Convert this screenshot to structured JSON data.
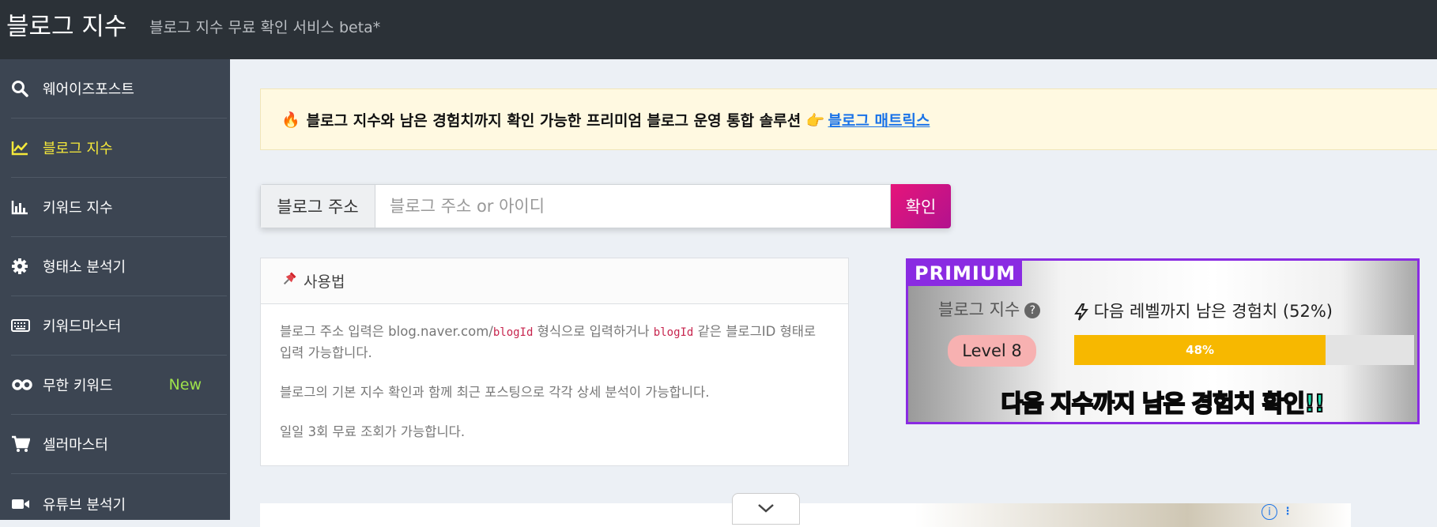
{
  "header": {
    "brand": "블로그 지수",
    "subtitle": "블로그 지수 무료 확인 서비스 beta*"
  },
  "sidebar": {
    "items": [
      {
        "label": "웨어이즈포스트",
        "icon": "search-icon"
      },
      {
        "label": "블로그 지수",
        "icon": "line-chart-icon",
        "active": true
      },
      {
        "label": "키워드 지수",
        "icon": "bar-chart-icon"
      },
      {
        "label": "형태소 분석기",
        "icon": "gear-icon"
      },
      {
        "label": "키워드마스터",
        "icon": "keyboard-icon"
      },
      {
        "label": "무한 키워드",
        "icon": "infinity-icon",
        "badge": "New"
      },
      {
        "label": "셀러마스터",
        "icon": "cart-icon"
      },
      {
        "label": "유튜브 분석기",
        "icon": "video-icon"
      }
    ],
    "active_color": "#f6e93a",
    "badge_color": "#9ee24b"
  },
  "notice": {
    "emoji": "🔥",
    "text": "블로그 지수와 남은 경험치까지 확인 가능한 프리미엄 블로그 운영 통합 솔루션 👉",
    "link": "블로그 매트릭스"
  },
  "search": {
    "label": "블로그 주소",
    "placeholder": "블로그 주소 or 아이디",
    "button": "확인"
  },
  "usage": {
    "title": "사용법",
    "line1_a": "블로그 주소 입력은 blog.naver.com/",
    "line1_code": "blogId",
    "line1_b": " 형식으로 입력하거나 ",
    "line1_code2": "blogId",
    "line1_c": " 같은 블로그ID 형태로 입력 가능합니다.",
    "line2": "블로그의 기본 지수 확인과 함께 최근 포스팅으로 각각 상세 분석이 가능합니다.",
    "line3": "일일 3회 무료 조회가 가능합니다."
  },
  "premium": {
    "tag": "PRIMIUM",
    "index_label": "블로그 지수",
    "help": "?",
    "exp_label": "다음 레벨까지 남은 경험치 (52%)",
    "level": "Level 8",
    "progress_text": "48%",
    "progress": 0.74,
    "headline": "다음 지수까지 남은 경험치 확인!!"
  },
  "ad": {
    "info": "i",
    "menu": "⋮"
  }
}
